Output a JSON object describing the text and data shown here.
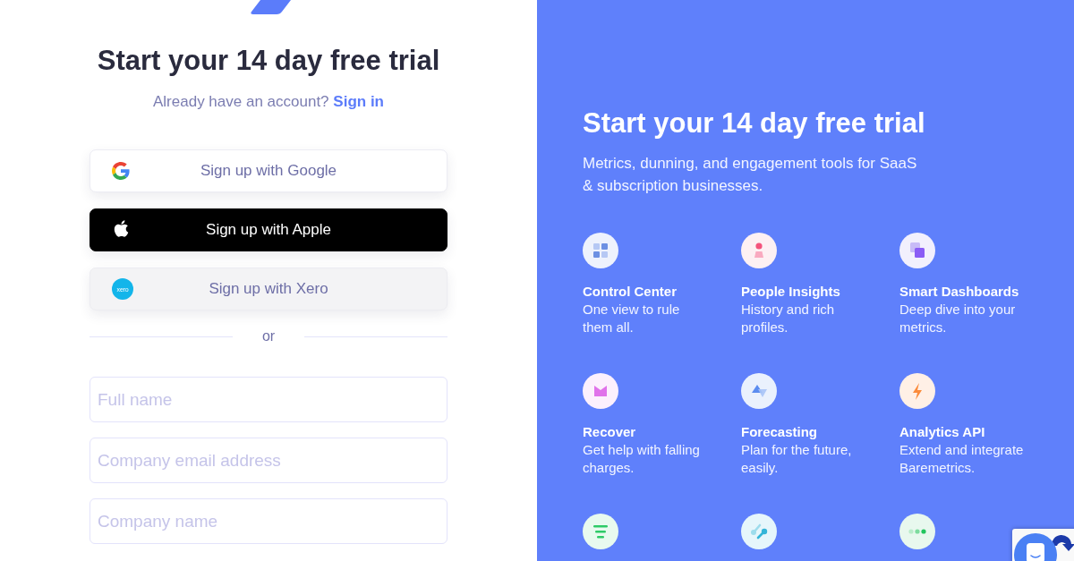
{
  "signup": {
    "title": "Start your 14 day free trial",
    "prompt": {
      "text": "Already have an account?",
      "link": "Sign in"
    },
    "providers": [
      {
        "kind": "google",
        "label": "Sign up with Google"
      },
      {
        "kind": "apple",
        "label": "Sign up with Apple"
      },
      {
        "kind": "xero",
        "label": "Sign up with Xero",
        "logo_text": "xero"
      }
    ],
    "divider": "or",
    "fields": [
      {
        "placeholder": "Full name"
      },
      {
        "placeholder": "Company email address"
      },
      {
        "placeholder": "Company name"
      }
    ]
  },
  "promo": {
    "title": "Start your 14 day free trial",
    "description": "Metrics, dunning, and engagement tools for SaaS & subscription businesses.",
    "features": [
      {
        "kind": "grid",
        "title": "Control Center",
        "description": "One view to rule them all."
      },
      {
        "kind": "person",
        "title": "People Insights",
        "description": "History and rich profiles."
      },
      {
        "kind": "layers",
        "title": "Smart Dashboards",
        "description": "Deep dive into your metrics."
      },
      {
        "kind": "envelope",
        "title": "Recover",
        "description": "Get help with falling charges."
      },
      {
        "kind": "triangles",
        "title": "Forecasting",
        "description": "Plan for the future, easily."
      },
      {
        "kind": "bolt",
        "title": "Analytics API",
        "description": "Extend and integrate Baremetrics."
      },
      {
        "kind": "lines"
      },
      {
        "kind": "link"
      },
      {
        "kind": "dots"
      }
    ]
  }
}
